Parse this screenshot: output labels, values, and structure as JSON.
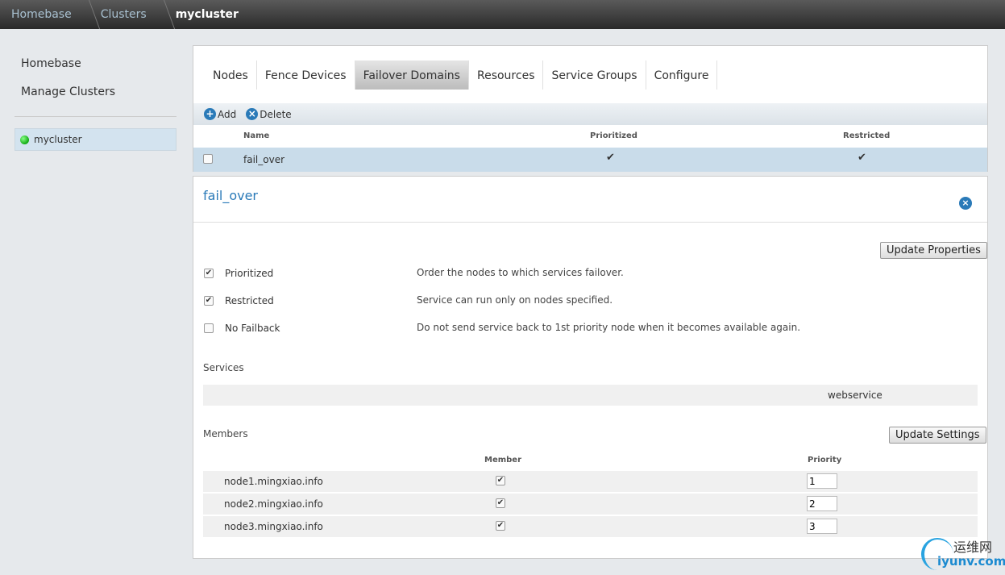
{
  "breadcrumb": [
    "Homebase",
    "Clusters",
    "mycluster"
  ],
  "sidebar": {
    "links": [
      "Homebase",
      "Manage Clusters"
    ],
    "cluster": "mycluster"
  },
  "tabs": [
    "Nodes",
    "Fence Devices",
    "Failover Domains",
    "Resources",
    "Service Groups",
    "Configure"
  ],
  "toolbar": {
    "add": "Add",
    "delete": "Delete"
  },
  "table": {
    "headers": [
      "Name",
      "Prioritized",
      "Restricted"
    ],
    "rows": [
      {
        "name": "fail_over",
        "prioritized": true,
        "restricted": true
      }
    ]
  },
  "detail": {
    "title": "fail_over",
    "update_properties": "Update Properties",
    "options": [
      {
        "label": "Prioritized",
        "checked": true,
        "desc": "Order the nodes to which services failover."
      },
      {
        "label": "Restricted",
        "checked": true,
        "desc": "Service can run only on nodes specified."
      },
      {
        "label": "No Failback",
        "checked": false,
        "desc": "Do not send service back to 1st priority node when it becomes available again."
      }
    ],
    "services_label": "Services",
    "service": "webservice",
    "members_label": "Members",
    "update_settings": "Update Settings",
    "member_headers": [
      "Member",
      "Priority"
    ],
    "members": [
      {
        "name": "node1.mingxiao.info",
        "member": true,
        "priority": "1"
      },
      {
        "name": "node2.mingxiao.info",
        "member": true,
        "priority": "2"
      },
      {
        "name": "node3.mingxiao.info",
        "member": true,
        "priority": "3"
      }
    ]
  },
  "watermark": {
    "cn": "运维网",
    "url": "iyunv.com"
  }
}
